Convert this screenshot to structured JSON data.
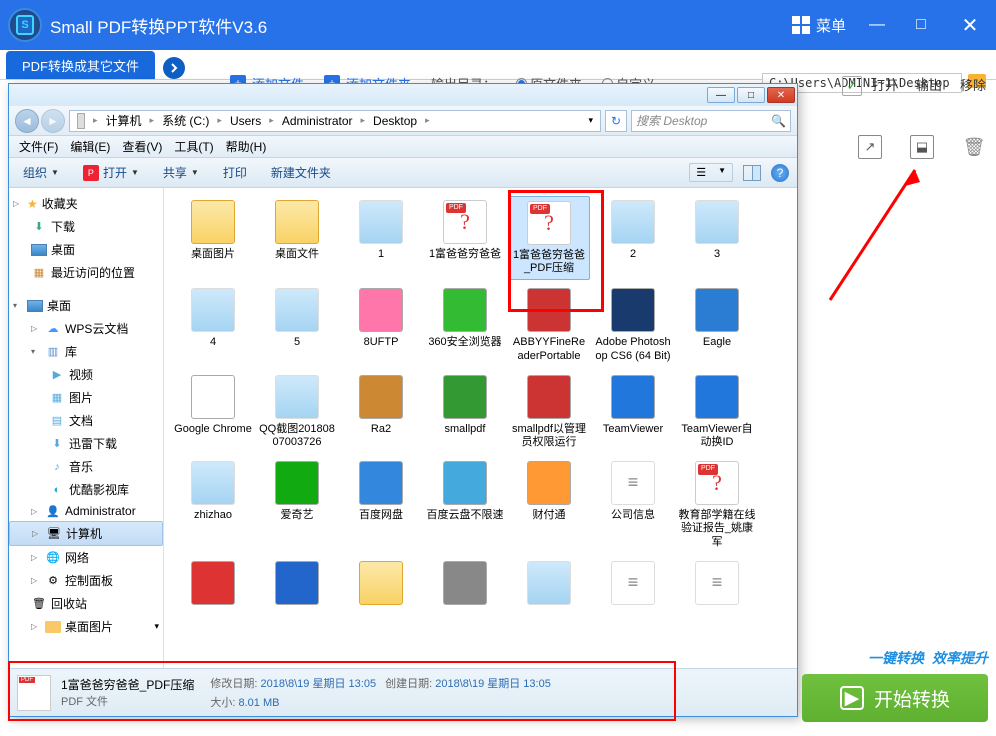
{
  "app": {
    "title": "Small  PDF转换PPT软件V3.6",
    "menu_label": "菜单",
    "active_tab": "PDF转换成其它文件",
    "add_file": "添加文件",
    "add_folder": "添加文件夹",
    "output_dir_label": "输出目录：",
    "radio_original": "原文件夹",
    "radio_custom": "自定义",
    "output_path": "C:\\Users\\ADMINI~1\\Desktop",
    "right_buttons": {
      "open": "打开",
      "export": "输出",
      "remove": "移除"
    },
    "brand1": "一键转换",
    "brand2": "效率提升",
    "start_button": "开始转换"
  },
  "explorer": {
    "breadcrumb": [
      "计算机",
      "系统 (C:)",
      "Users",
      "Administrator",
      "Desktop"
    ],
    "search_placeholder": "搜索 Desktop",
    "menubar": [
      "文件(F)",
      "编辑(E)",
      "查看(V)",
      "工具(T)",
      "帮助(H)"
    ],
    "toolbar": {
      "organize": "组织",
      "open": "打开",
      "share": "共享",
      "print": "打印",
      "new_folder": "新建文件夹"
    },
    "sidebar": {
      "favorites": {
        "label": "收藏夹",
        "items": [
          "下载",
          "桌面",
          "最近访问的位置"
        ]
      },
      "desktop": {
        "label": "桌面",
        "items": [
          "WPS云文档",
          {
            "label": "库",
            "children": [
              "视频",
              "图片",
              "文档",
              "迅雷下载",
              "音乐",
              "优酷影视库"
            ]
          },
          "Administrator",
          "计算机",
          "网络",
          "控制面板",
          "回收站",
          "桌面图片"
        ]
      }
    },
    "files": [
      {
        "name": "桌面图片",
        "type": "folder"
      },
      {
        "name": "桌面文件",
        "type": "folder"
      },
      {
        "name": "1",
        "type": "pic"
      },
      {
        "name": "1富爸爸穷爸爸",
        "type": "pdf"
      },
      {
        "name": "1富爸爸穷爸爸_PDF压缩",
        "type": "pdf",
        "selected": true
      },
      {
        "name": "2",
        "type": "pic"
      },
      {
        "name": "3",
        "type": "pic"
      },
      {
        "name": "4",
        "type": "pic"
      },
      {
        "name": "5",
        "type": "pic"
      },
      {
        "name": "8UFTP",
        "type": "app",
        "color": "#f7a"
      },
      {
        "name": "360安全浏览器",
        "type": "app",
        "color": "#3b3"
      },
      {
        "name": "ABBYYFineReaderPortable",
        "type": "app",
        "color": "#c33"
      },
      {
        "name": "Adobe Photoshop CS6 (64 Bit)",
        "type": "app",
        "color": "#183a6d"
      },
      {
        "name": "Eagle",
        "type": "app",
        "color": "#2a7dd2"
      },
      {
        "name": "Google Chrome",
        "type": "app",
        "color": "#fff"
      },
      {
        "name": "QQ截图20180807003726",
        "type": "pic"
      },
      {
        "name": "Ra2",
        "type": "app",
        "color": "#c83"
      },
      {
        "name": "smallpdf",
        "type": "app",
        "color": "#393"
      },
      {
        "name": "smallpdf以管理员权限运行",
        "type": "app",
        "color": "#c33"
      },
      {
        "name": "TeamViewer",
        "type": "app",
        "color": "#27d"
      },
      {
        "name": "TeamViewer自动换ID",
        "type": "app",
        "color": "#27d"
      },
      {
        "name": "zhizhao",
        "type": "pic"
      },
      {
        "name": "爱奇艺",
        "type": "app",
        "color": "#1a1"
      },
      {
        "name": "百度网盘",
        "type": "app",
        "color": "#38d"
      },
      {
        "name": "百度云盘不限速",
        "type": "app",
        "color": "#4ad"
      },
      {
        "name": "财付通",
        "type": "app",
        "color": "#f93"
      },
      {
        "name": "公司信息",
        "type": "doc"
      },
      {
        "name": "教育部学籍在线验证报告_姚康军",
        "type": "pdf"
      },
      {
        "name": "",
        "type": "app",
        "color": "#d33"
      },
      {
        "name": "",
        "type": "app",
        "color": "#26c"
      },
      {
        "name": "",
        "type": "folder"
      },
      {
        "name": "",
        "type": "app",
        "color": "#888"
      },
      {
        "name": "",
        "type": "pic"
      },
      {
        "name": "",
        "type": "doc"
      },
      {
        "name": "",
        "type": "doc"
      }
    ],
    "details": {
      "name": "1富爸爸穷爸爸_PDF压缩",
      "type_label": "PDF 文件",
      "mod_label": "修改日期:",
      "mod_value": "2018\\8\\19 星期日 13:05",
      "create_label": "创建日期:",
      "create_value": "2018\\8\\19 星期日 13:05",
      "size_label": "大小:",
      "size_value": "8.01 MB"
    }
  }
}
